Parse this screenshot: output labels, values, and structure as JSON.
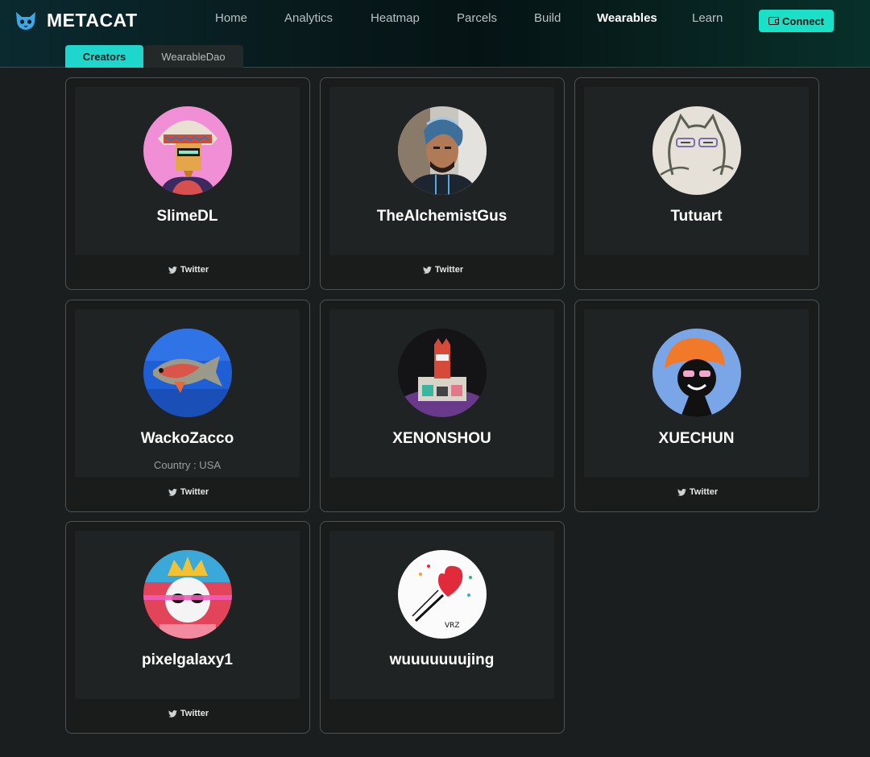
{
  "app": {
    "brand": "METACAT"
  },
  "nav": {
    "items": [
      "Home",
      "Analytics",
      "Heatmap",
      "Parcels",
      "Build",
      "Wearables",
      "Learn"
    ],
    "active": "Wearables",
    "connect_label": "Connect"
  },
  "tabs": {
    "items": [
      "Creators",
      "WearableDao"
    ],
    "active": "Creators"
  },
  "creators": [
    {
      "name": "SlimeDL",
      "country": "",
      "twitter": "Twitter"
    },
    {
      "name": "TheAlchemistGus",
      "country": "",
      "twitter": "Twitter"
    },
    {
      "name": "Tutuart",
      "country": "",
      "twitter": ""
    },
    {
      "name": "WackoZacco",
      "country": "Country : USA",
      "twitter": "Twitter"
    },
    {
      "name": "XENONSHOU",
      "country": "",
      "twitter": ""
    },
    {
      "name": "XUECHUN",
      "country": "",
      "twitter": "Twitter"
    },
    {
      "name": "pixelgalaxy1",
      "country": "",
      "twitter": "Twitter"
    },
    {
      "name": "wuuuuuuujing",
      "country": "",
      "twitter": ""
    }
  ],
  "colors": {
    "accent": "#19e0c7",
    "background": "#1b1e1e",
    "card_border": "#4e5252"
  }
}
